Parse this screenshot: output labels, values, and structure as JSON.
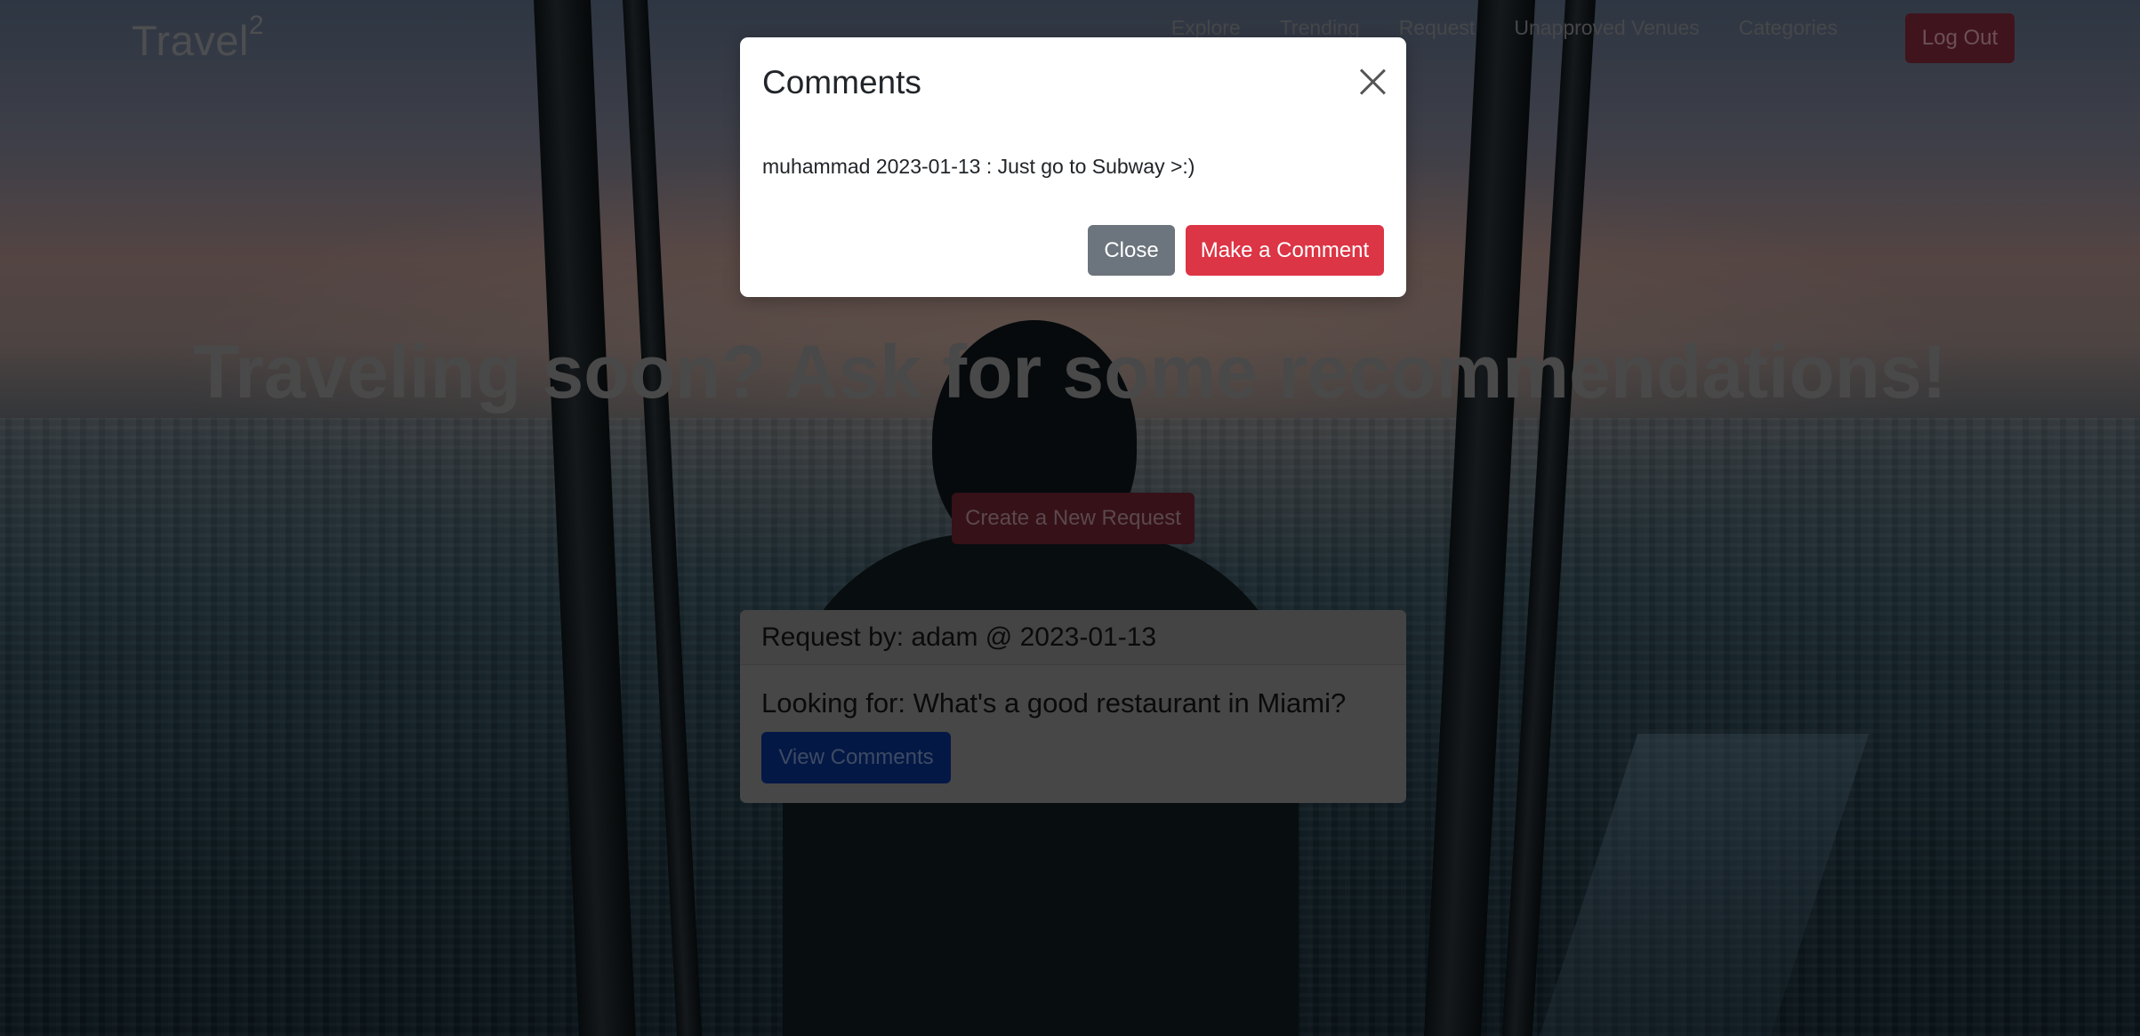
{
  "navbar": {
    "brand": "Travel",
    "brand_sup": "2",
    "links": [
      "Explore",
      "Trending",
      "Request",
      "Unapproved Venues",
      "Categories"
    ],
    "logout_label": "Log Out"
  },
  "hero": {
    "headline": "Traveling soon? Ask for some recommendations!",
    "create_request_label": "Create a New Request"
  },
  "request_card": {
    "header": "Request by: adam @ 2023-01-13",
    "body": "Looking for: What's a good restaurant in Miami?",
    "view_comments_label": "View Comments"
  },
  "modal": {
    "title": "Comments",
    "comment": "muhammad 2023-01-13 : Just go to Subway >:)",
    "close_label": "Close",
    "make_comment_label": "Make a Comment"
  },
  "colors": {
    "primary": "#0d6efd",
    "danger": "#dc3545",
    "secondary": "#6c757d"
  },
  "icons": {
    "modal_close": "close-icon"
  }
}
